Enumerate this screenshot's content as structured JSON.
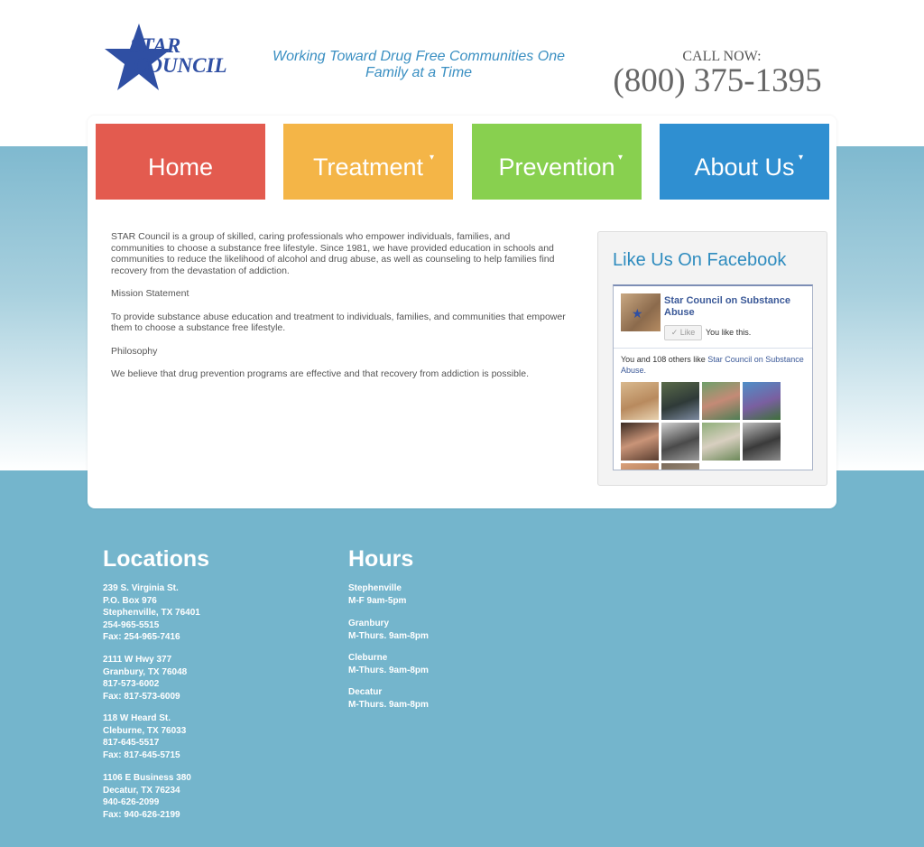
{
  "header": {
    "logo_line1": "STAR",
    "logo_line2": "COUNCIL",
    "tagline": "Working Toward Drug Free Communities One Family at a Time",
    "call_label": "CALL NOW:",
    "phone": "(800) 375-1395"
  },
  "nav": {
    "home": "Home",
    "treatment": "Treatment",
    "prevention": "Prevention",
    "about": "About Us",
    "caret": "▾"
  },
  "content": {
    "intro": "STAR Council is a group of skilled, caring professionals who empower individuals, families, and communities to choose a substance free lifestyle. Since 1981, we have provided education in schools and communities to reduce the likelihood of alcohol and drug abuse, as well as counseling to help families find recovery from the devastation of addiction.",
    "mission_heading": "Mission Statement",
    "mission_text": "To provide substance abuse education and treatment to individuals, families, and communities that empower them to choose a substance free lifestyle.",
    "philosophy_heading": "Philosophy",
    "philosophy_text": "We believe that drug prevention programs are effective and that recovery from addiction is possible."
  },
  "facebook": {
    "heading": "Like Us On Facebook",
    "page_name": "Star Council on Substance Abuse",
    "like_button": "✓ Like",
    "you_like": "You like this.",
    "count_prefix": "You and 108 others like ",
    "count_link": "Star Council on Substance Abuse."
  },
  "footer": {
    "locations_title": "Locations",
    "hours_title": "Hours",
    "locations": [
      [
        "239 S. Virginia St.",
        "P.O. Box 976",
        "Stephenville, TX 76401",
        "254-965-5515",
        "Fax: 254-965-7416"
      ],
      [
        "2111 W Hwy 377",
        "Granbury, TX 76048",
        "817-573-6002",
        "Fax: 817-573-6009"
      ],
      [
        "118 W Heard St.",
        "Cleburne, TX 76033",
        "817-645-5517",
        "Fax: 817-645-5715"
      ],
      [
        "1106 E Business 380",
        "Decatur, TX 76234",
        "940-626-2099",
        "Fax: 940-626-2199"
      ]
    ],
    "hours": [
      [
        "Stephenville",
        "M-F 9am-5pm"
      ],
      [
        "Granbury",
        "M-Thurs. 9am-8pm"
      ],
      [
        "Cleburne",
        "M-Thurs. 9am-8pm"
      ],
      [
        "Decatur",
        "M-Thurs. 9am-8pm"
      ]
    ]
  },
  "colors": {
    "home": "#e35b4f",
    "treatment": "#f4b547",
    "prevention": "#88d04f",
    "about": "#2f8fd1",
    "footer_bg": "#74b5cc"
  }
}
